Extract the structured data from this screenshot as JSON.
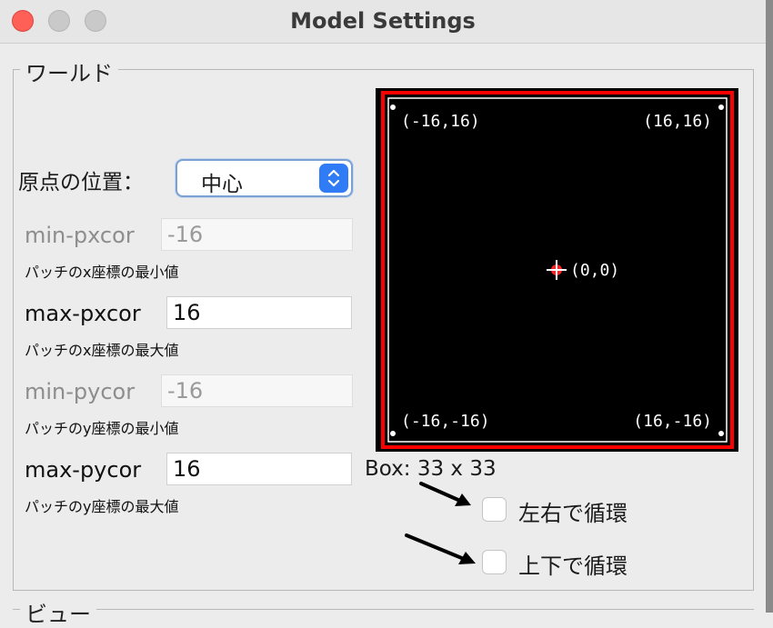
{
  "window": {
    "title": "Model Settings"
  },
  "world_section": {
    "legend": "ワールド"
  },
  "view_section": {
    "legend": "ビュー"
  },
  "origin": {
    "label": "原点の位置：",
    "selected": "中心"
  },
  "fields": {
    "min_pxcor": {
      "label": "min-pxcor",
      "value": "-16",
      "desc": "パッチのx座標の最小値",
      "enabled": false
    },
    "max_pxcor": {
      "label": "max-pxcor",
      "value": "16",
      "desc": "パッチのx座標の最大値",
      "enabled": true
    },
    "min_pycor": {
      "label": "min-pycor",
      "value": "-16",
      "desc": "パッチのy座標の最小値",
      "enabled": false
    },
    "max_pycor": {
      "label": "max-pycor",
      "value": "16",
      "desc": "パッチのy座標の最大値",
      "enabled": true
    }
  },
  "preview": {
    "top_left": "(-16,16)",
    "top_right": "(16,16)",
    "center": "(0,0)",
    "bottom_left": "(-16,-16)",
    "bottom_right": "(16,-16)",
    "box_label": "Box: 33 x 33"
  },
  "wrap": {
    "horizontal": {
      "label": "左右で循環",
      "checked": false
    },
    "vertical": {
      "label": "上下で循環",
      "checked": false
    }
  },
  "colors": {
    "accent": "#2f7cf6",
    "boundary": "#ff0000",
    "world_bg": "#000000",
    "close": "#fe5f57"
  },
  "icons": [
    "close-icon",
    "minimize-icon",
    "zoom-icon",
    "updown-chevron-icon",
    "origin-crosshair-icon",
    "arrow-icon"
  ]
}
